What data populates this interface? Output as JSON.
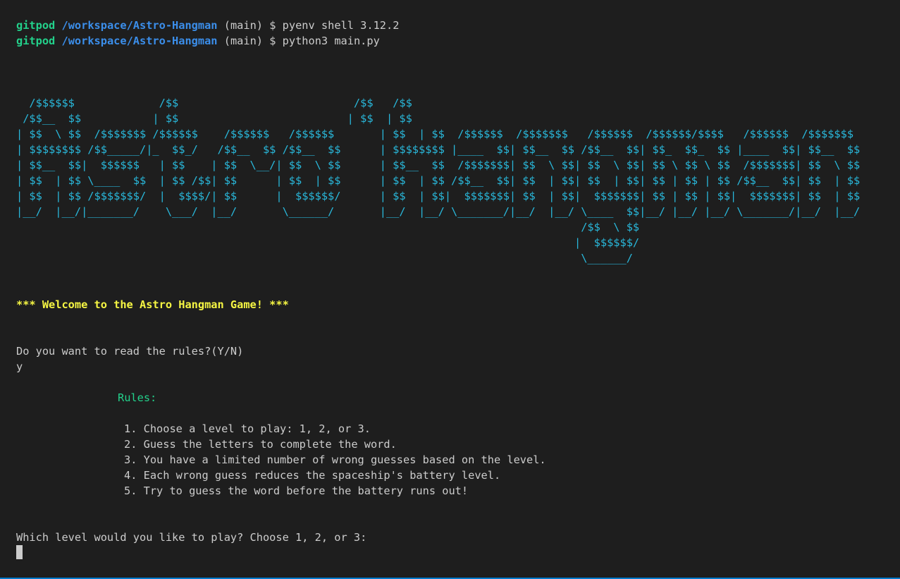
{
  "prompt_lines": [
    {
      "user": "gitpod",
      "path": "/workspace/Astro-Hangman",
      "branch": "(main)",
      "symbol": "$",
      "command": "pyenv shell 3.12.2"
    },
    {
      "user": "gitpod",
      "path": "/workspace/Astro-Hangman",
      "branch": "(main)",
      "symbol": "$",
      "command": "python3 main.py"
    }
  ],
  "ascii_art": [
    "  /$$$$$$             /$$                           /$$   /$$",
    " /$$__  $$           | $$                          | $$  | $$",
    "| $$  \\ $$  /$$$$$$$ /$$$$$$    /$$$$$$   /$$$$$$       | $$  | $$  /$$$$$$  /$$$$$$$   /$$$$$$  /$$$$$$/$$$$   /$$$$$$  /$$$$$$$",
    "| $$$$$$$$ /$$_____/|_  $$_/   /$$__  $$ /$$__  $$      | $$$$$$$$ |____  $$| $$__  $$ /$$__  $$| $$_  $$_  $$ |____  $$| $$__  $$",
    "| $$__  $$|  $$$$$$   | $$    | $$  \\__/| $$  \\ $$      | $$__  $$  /$$$$$$$| $$  \\ $$| $$  \\ $$| $$ \\ $$ \\ $$  /$$$$$$$| $$  \\ $$",
    "| $$  | $$ \\____  $$  | $$ /$$| $$      | $$  | $$      | $$  | $$ /$$__  $$| $$  | $$| $$  | $$| $$ | $$ | $$ /$$__  $$| $$  | $$",
    "| $$  | $$ /$$$$$$$/  |  $$$$/| $$      |  $$$$$$/      | $$  | $$|  $$$$$$$| $$  | $$|  $$$$$$$| $$ | $$ | $$|  $$$$$$$| $$  | $$",
    "|__/  |__/|_______/    \\___/  |__/       \\______/       |__/  |__/ \\_______/|__/  |__/ \\____  $$|__/ |__/ |__/ \\_______/|__/  |__/",
    "                                                                                       /$$  \\ $$",
    "                                                                                      |  $$$$$$/",
    "                                                                                       \\______/"
  ],
  "welcome": "*** Welcome to the Astro Hangman Game! ***",
  "rules_question": "Do you want to read the rules?(Y/N)",
  "user_answer": "y",
  "rules_title": "Rules:",
  "rules": [
    "1. Choose a level to play: 1, 2, or 3.",
    "2. Guess the letters to complete the word.",
    "3. You have a limited number of wrong guesses based on the level.",
    "4. Each wrong guess reduces the spaceship's battery level.",
    "5. Try to guess the word before the battery runs out!"
  ],
  "level_prompt": "Which level would you like to play? Choose 1, 2, or 3:",
  "colors": {
    "background": "#1e1e1e",
    "text": "#cccccc",
    "user": "#23d18b",
    "path": "#3b8eea",
    "ascii": "#29b8db",
    "welcome": "#f5f543",
    "rules_title": "#23d18b",
    "focus_border": "#007acc"
  }
}
